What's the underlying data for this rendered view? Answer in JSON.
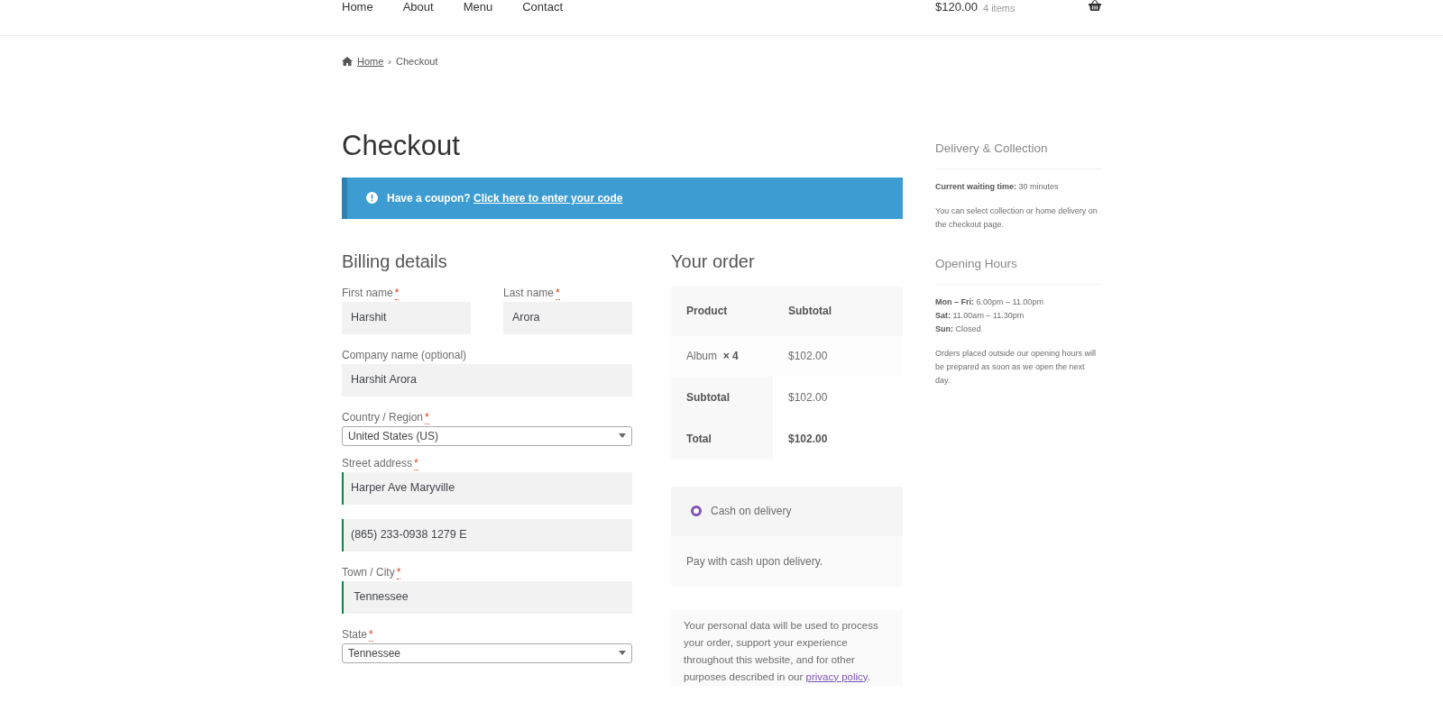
{
  "nav": {
    "links": [
      "Home",
      "About",
      "Menu",
      "Contact"
    ],
    "cart_total": "$120.00",
    "cart_count": "4 items"
  },
  "breadcrumb": {
    "home": "Home",
    "separator": "›",
    "current": "Checkout"
  },
  "page_title": "Checkout",
  "coupon": {
    "text": "Have a coupon?",
    "link": "Click here to enter your code"
  },
  "billing": {
    "title": "Billing details",
    "rows": [
      [
        {
          "kind": "text",
          "label": "First name",
          "required_mark": "*",
          "value": "Harshit"
        },
        {
          "kind": "text",
          "label": "Last name",
          "required_mark": "*",
          "value": "Arora"
        }
      ],
      [
        {
          "kind": "text",
          "label": "Company name (optional)",
          "value": "Harshit Arora"
        }
      ],
      [
        {
          "kind": "select",
          "label": "Country / Region",
          "required_mark": "*",
          "value": "United States (US)"
        }
      ],
      [
        {
          "kind": "text",
          "label": "Street address",
          "required_mark": "*",
          "value": "Harper Ave Maryville",
          "valid": true
        }
      ],
      [
        {
          "kind": "text",
          "value": "(865) 233-0938 1279 E",
          "valid": true
        }
      ],
      [
        {
          "kind": "text",
          "label": "Town / City",
          "required_mark": "*",
          "value": " Tennessee",
          "valid": true
        }
      ],
      [
        {
          "kind": "select",
          "label": "State",
          "required_mark": "*",
          "value": "Tennessee"
        }
      ]
    ]
  },
  "order": {
    "title": "Your order",
    "columns": [
      "Product",
      "Subtotal"
    ],
    "items": [
      {
        "name": "Album",
        "quantity": "× 4",
        "subtotal": "$102.00"
      }
    ],
    "totals": [
      {
        "label": "Subtotal",
        "value": "$102.00",
        "bold": false
      },
      {
        "label": "Total",
        "value": "$102.00",
        "bold": true
      }
    ],
    "payment": [
      {
        "label": "Cash on delivery",
        "selected": true,
        "description": "Pay with cash upon delivery."
      }
    ],
    "privacy": {
      "text": "Your personal data will be used to process your order, support your experience throughout this website, and for other purposes described in our",
      "link": "privacy policy",
      "end": "."
    }
  },
  "sidebar": [
    {
      "title": "Delivery & Collection",
      "paragraphs": [
        [
          "**Current waiting time:** 30 minutes"
        ],
        [
          "You can select collection or home delivery on the checkout page."
        ]
      ]
    },
    {
      "title": "Opening Hours",
      "paragraphs": [
        [
          "**Mon – Fri:** 6.00pm – 11.00pm",
          "**Sat:** 11.00am – 11.30pm",
          "**Sun:** Closed"
        ],
        [
          "Orders placed outside our opening hours will be prepared as soon as we open the next day."
        ]
      ]
    }
  ]
}
